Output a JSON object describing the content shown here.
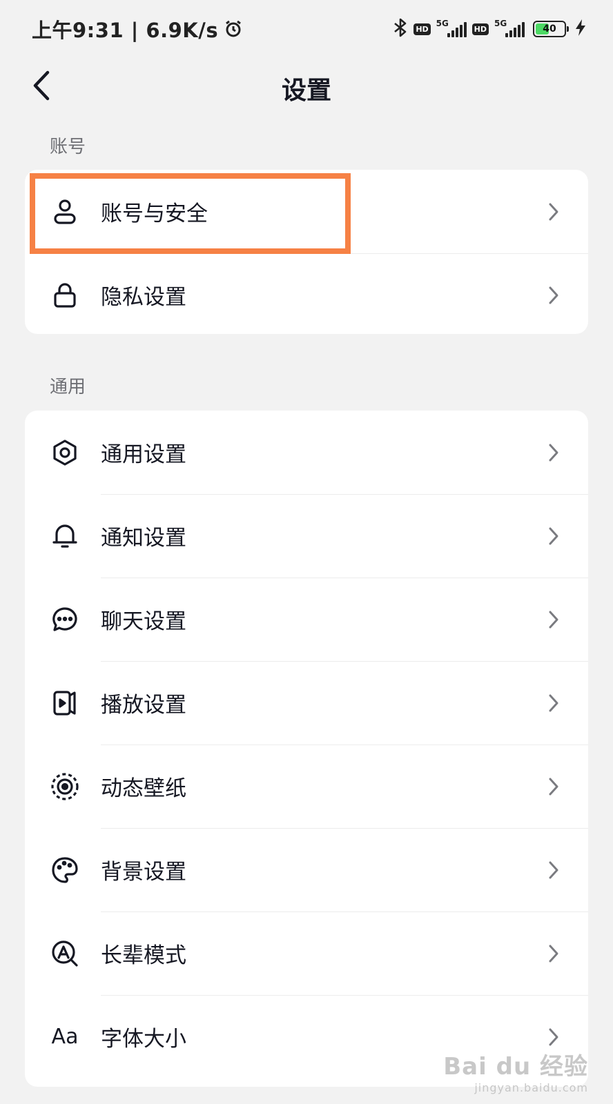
{
  "status_bar": {
    "time_speed": "上午9:31 | 6.9K/s",
    "hd_label": "HD",
    "network_label": "5G",
    "battery_level": "40",
    "icons": [
      "alarm-icon",
      "bluetooth-icon",
      "signal-icon",
      "battery-icon",
      "charging-icon"
    ]
  },
  "header": {
    "title": "设置",
    "back_icon": "chevron-left-icon"
  },
  "sections": [
    {
      "label": "账号",
      "items": [
        {
          "label": "账号与安全",
          "icon": "user-icon",
          "highlighted": true
        },
        {
          "label": "隐私设置",
          "icon": "lock-icon"
        }
      ]
    },
    {
      "label": "通用",
      "items": [
        {
          "label": "通用设置",
          "icon": "gear-icon"
        },
        {
          "label": "通知设置",
          "icon": "bell-icon"
        },
        {
          "label": "聊天设置",
          "icon": "chat-bubble-icon"
        },
        {
          "label": "播放设置",
          "icon": "play-icon"
        },
        {
          "label": "动态壁纸",
          "icon": "wallpaper-icon"
        },
        {
          "label": "背景设置",
          "icon": "palette-icon"
        },
        {
          "label": "长辈模式",
          "icon": "elder-mode-icon"
        },
        {
          "label": "字体大小",
          "icon": "font-size-icon",
          "icon_text": "Aa"
        }
      ]
    }
  ],
  "watermark": {
    "main": "Bai du 经验",
    "sub": "jingyan.baidu.com"
  },
  "colors": {
    "background": "#f2f2f2",
    "card": "#ffffff",
    "highlight": "#f68145",
    "text": "#161823",
    "section_label": "#6e6f74",
    "battery_fill": "#4cd964"
  }
}
